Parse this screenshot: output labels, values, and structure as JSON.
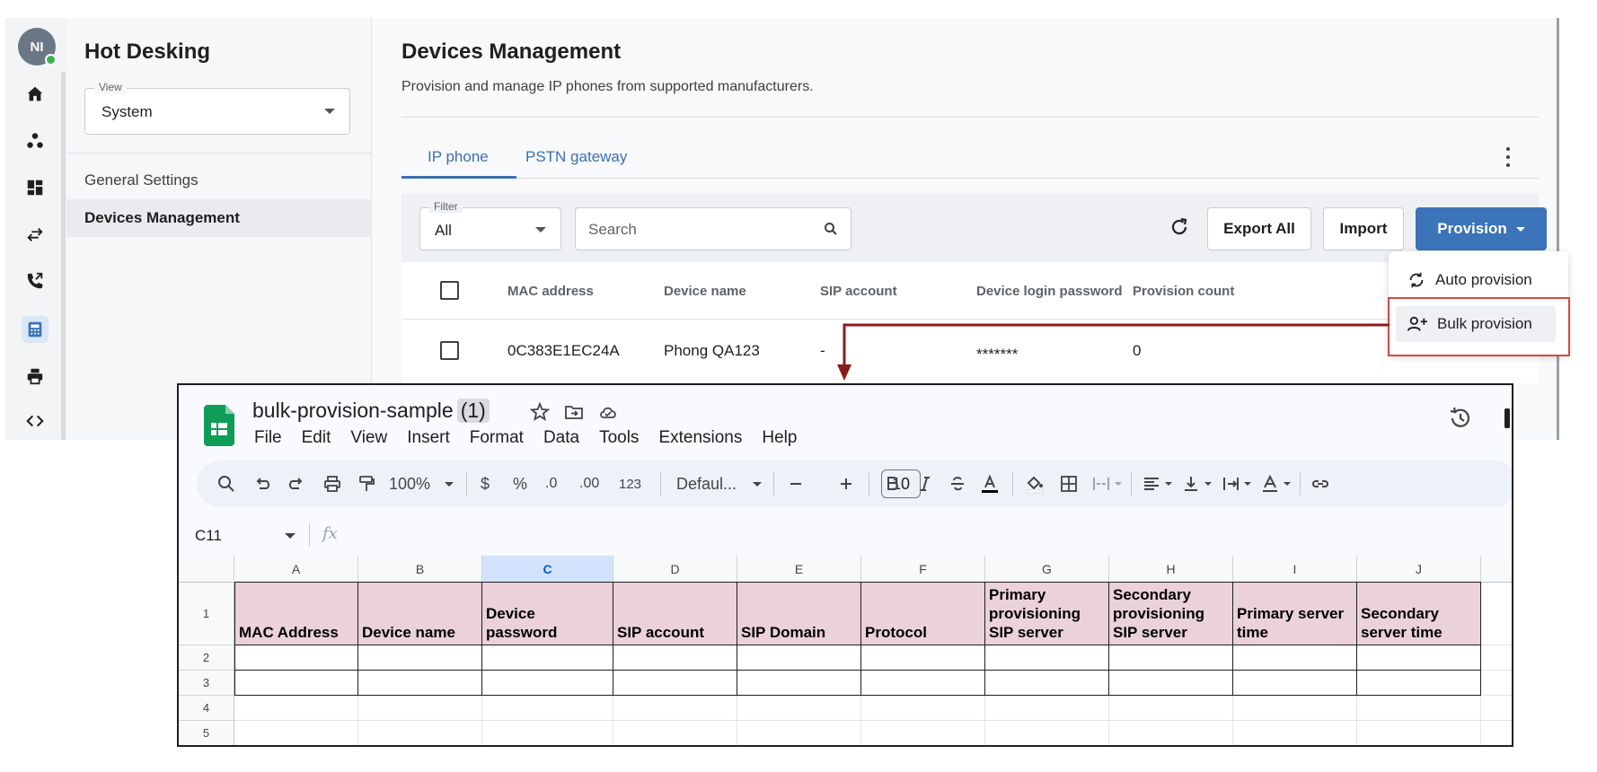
{
  "app": {
    "avatar_initials": "NI",
    "sidebar": {
      "title": "Hot Desking",
      "view_label": "View",
      "view_value": "System",
      "items": [
        {
          "label": "General Settings"
        },
        {
          "label": "Devices Management"
        }
      ]
    },
    "rail_icons": [
      "home-icon",
      "cluster-icon",
      "dashboard-icon",
      "transfer-icon",
      "call-forward-icon",
      "phone-device-icon",
      "printer-icon",
      "code-icon"
    ],
    "main": {
      "title": "Devices Management",
      "subtitle": "Provision and manage IP phones from supported manufacturers.",
      "tabs": [
        {
          "label": "IP phone"
        },
        {
          "label": "PSTN gateway"
        }
      ],
      "filter_label": "Filter",
      "filter_value": "All",
      "search_placeholder": "Search",
      "export_label": "Export All",
      "import_label": "Import",
      "provision_label": "Provision",
      "columns": [
        "MAC address",
        "Device name",
        "SIP account",
        "Device login password",
        "Provision count"
      ],
      "rows": [
        {
          "mac": "0C383E1EC24A",
          "name": "Phong QA123",
          "sip": "-",
          "password": "*******",
          "count": "0"
        }
      ],
      "menu": [
        {
          "label": "Auto provision"
        },
        {
          "label": "Bulk provision"
        }
      ]
    },
    "colors": {
      "accent": "#3b74b9",
      "highlight": "#d64a3f",
      "arrow": "#8b1a1a",
      "header_fill": "#ead1dc"
    }
  },
  "sheet": {
    "title": "bulk-provision-sample",
    "title_suffix": "(1)",
    "menu": [
      "File",
      "Edit",
      "View",
      "Insert",
      "Format",
      "Data",
      "Tools",
      "Extensions",
      "Help"
    ],
    "toolbar": {
      "zoom": "100%",
      "currency": "$",
      "percent": "%",
      "dec_less": ".0",
      "dec_more": ".00",
      "number_format": "123",
      "font": "Defaul...",
      "font_size": "10"
    },
    "namebox": "C11",
    "fx": "fx",
    "columns": [
      "A",
      "B",
      "C",
      "D",
      "E",
      "F",
      "G",
      "H",
      "I",
      "J"
    ],
    "selected_column": "C",
    "row_numbers": [
      "1",
      "2",
      "3",
      "4",
      "5"
    ],
    "headers": [
      "MAC Address",
      "Device name",
      "Device password",
      "SIP account",
      "SIP Domain",
      "Protocol",
      "Primary provisioning SIP server",
      "Secondary provisioning SIP server",
      "Primary server time",
      "Secondary server time"
    ]
  }
}
